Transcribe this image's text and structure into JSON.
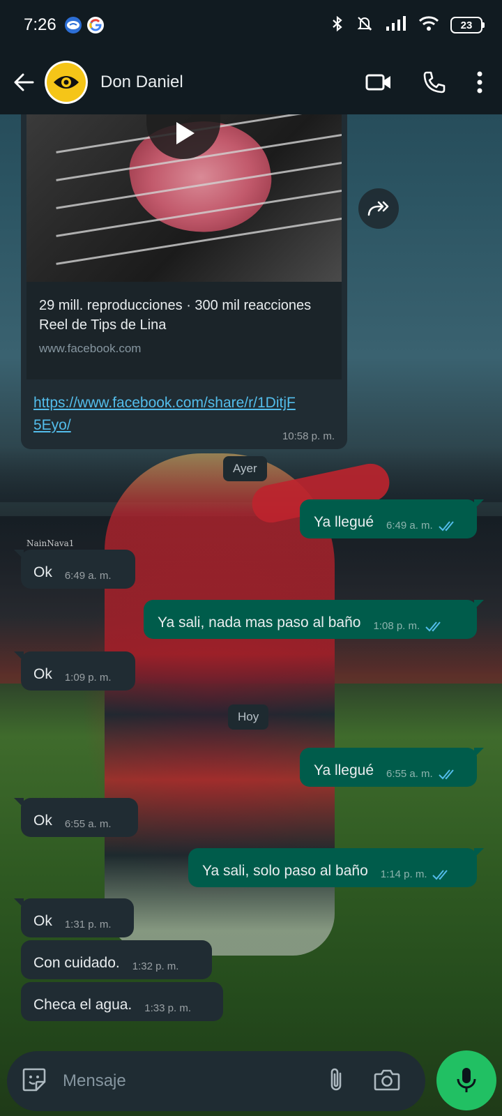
{
  "status_bar": {
    "time": "7:26",
    "battery": "23"
  },
  "header": {
    "contact_name": "Don Daniel"
  },
  "link_message": {
    "stats": "29 mill. reproducciones · 300 mil reacciones",
    "title": "Reel de Tips de Lina",
    "domain": "www.facebook.com",
    "url": "https://www.facebook.com/share/r/1DitjF5Eyo/",
    "time": "10:58 p. m."
  },
  "wallpaper_watermark": "NainNava1",
  "messages": [
    {
      "type": "date",
      "text": "Ayer"
    },
    {
      "type": "out",
      "text": "Ya llegué",
      "time": "6:49 a. m."
    },
    {
      "type": "in",
      "text": "Ok",
      "time": "6:49 a. m."
    },
    {
      "type": "out",
      "text": "Ya sali, nada mas paso al baño",
      "time": "1:08 p. m."
    },
    {
      "type": "in",
      "text": "Ok",
      "time": "1:09 p. m."
    },
    {
      "type": "date",
      "text": "Hoy"
    },
    {
      "type": "out",
      "text": "Ya llegué",
      "time": "6:55 a. m."
    },
    {
      "type": "in",
      "text": "Ok",
      "time": "6:55 a. m."
    },
    {
      "type": "out",
      "text": "Ya sali, solo paso al baño",
      "time": "1:14 p. m."
    },
    {
      "type": "in",
      "text": "Ok",
      "time": "1:31 p. m."
    },
    {
      "type": "in",
      "text": "Con cuidado.",
      "time": "1:32 p. m."
    },
    {
      "type": "in",
      "text": "Checa el agua.",
      "time": "1:33 p. m."
    }
  ],
  "input": {
    "placeholder": "Mensaje"
  },
  "colors": {
    "incoming_bubble": "#202c33",
    "outgoing_bubble": "#005c4b",
    "read_ticks": "#53bdeb",
    "mic_button": "#21c063",
    "link": "#53bdeb"
  }
}
